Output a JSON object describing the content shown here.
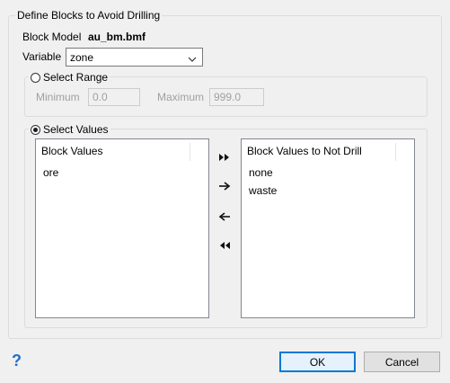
{
  "group_title": "Define Blocks to Avoid Drilling",
  "block_model": {
    "label": "Block Model",
    "value": "au_bm.bmf"
  },
  "variable": {
    "label": "Variable",
    "value": "zone"
  },
  "select_range": {
    "label": "Select Range",
    "selected": false,
    "minimum_label": "Minimum",
    "minimum_value": "0.0",
    "maximum_label": "Maximum",
    "maximum_value": "999.0"
  },
  "select_values": {
    "label": "Select Values",
    "selected": true,
    "left_list": {
      "header": "Block Values",
      "items": [
        "ore"
      ]
    },
    "right_list": {
      "header": "Block Values to Not Drill",
      "items": [
        "none",
        "waste"
      ]
    }
  },
  "buttons": {
    "ok": "OK",
    "cancel": "Cancel",
    "help": "?"
  },
  "colors": {
    "help_icon": "#1f6fc5",
    "default_button_border": "#0078d7"
  }
}
